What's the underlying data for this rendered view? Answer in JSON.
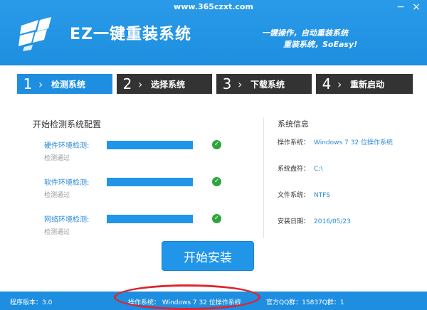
{
  "window": {
    "url": "www.365czxt.com",
    "minimize_glyph": "−",
    "close_glyph": "×"
  },
  "header": {
    "title": "EZ一键重装系统",
    "slogan_line1": "一键操作，自动重装系统",
    "slogan_line2": "重装系统，SoEasy!"
  },
  "steps": [
    {
      "num": "1",
      "label": "检测系统",
      "active": true
    },
    {
      "num": "2",
      "label": "选择系统",
      "active": false
    },
    {
      "num": "3",
      "label": "下载系统",
      "active": false
    },
    {
      "num": "4",
      "label": "重新启动",
      "active": false
    }
  ],
  "check": {
    "title": "开始检测系统配置",
    "items": [
      {
        "label": "硬件环境检测:",
        "status": "检测通过"
      },
      {
        "label": "软件环境检测:",
        "status": "检测通过"
      },
      {
        "label": "网络环境检测:",
        "status": "检测通过"
      }
    ]
  },
  "sysinfo": {
    "title": "系统信息",
    "rows": [
      {
        "key": "操作系统：",
        "value": "Windows 7 32 位操作系统"
      },
      {
        "key": "系统盘符：",
        "value": "C:\\"
      },
      {
        "key": "文件系统：",
        "value": "NTFS"
      },
      {
        "key": "安装日期：",
        "value": "2016/05/23"
      }
    ]
  },
  "install_button": "开始安装",
  "footer": {
    "version": "程序版本：3.0",
    "os": "操作系统：  Windows 7 32 位操作系统",
    "qq": "官方QQ群：15837Q群：1"
  },
  "colors": {
    "brand_blue": "#1e8ee0",
    "step_inactive": "#333333",
    "ok_green": "#2fa43c",
    "annotation_red": "#e0242c"
  }
}
